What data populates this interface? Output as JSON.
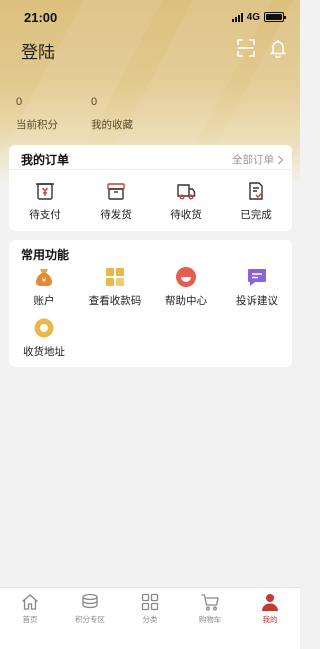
{
  "status_bar": {
    "time": "21:00",
    "network": "4G"
  },
  "header": {
    "title": "登陆"
  },
  "stats": {
    "points": {
      "value": "0",
      "label": "当前积分"
    },
    "favorites": {
      "value": "0",
      "label": "我的收藏"
    }
  },
  "orders": {
    "title": "我的订单",
    "all_link": "全部订单",
    "items": [
      {
        "label": "待支付",
        "icon": "wallet-icon"
      },
      {
        "label": "待发货",
        "icon": "package-icon"
      },
      {
        "label": "待收货",
        "icon": "truck-icon"
      },
      {
        "label": "已完成",
        "icon": "document-check-icon"
      }
    ]
  },
  "services": {
    "title": "常用功能",
    "items": [
      {
        "label": "账户",
        "icon": "money-bag-icon"
      },
      {
        "label": "查看收款码",
        "icon": "grid-code-icon"
      },
      {
        "label": "帮助中心",
        "icon": "smile-icon"
      },
      {
        "label": "投诉建议",
        "icon": "chat-icon"
      },
      {
        "label": "收货地址",
        "icon": "location-ring-icon"
      }
    ]
  },
  "tabbar": {
    "items": [
      {
        "label": "首页",
        "icon": "home-icon"
      },
      {
        "label": "积分专区",
        "icon": "coins-icon"
      },
      {
        "label": "分类",
        "icon": "category-icon"
      },
      {
        "label": "购物车",
        "icon": "cart-icon"
      },
      {
        "label": "我的",
        "icon": "profile-icon",
        "active": true
      }
    ]
  },
  "colors": {
    "header_gold": "#dcc07f",
    "accent_red": "#c43a34",
    "icon_orange": "#e38a36",
    "icon_yellow": "#e9b84a",
    "icon_purple": "#8a63d6"
  }
}
